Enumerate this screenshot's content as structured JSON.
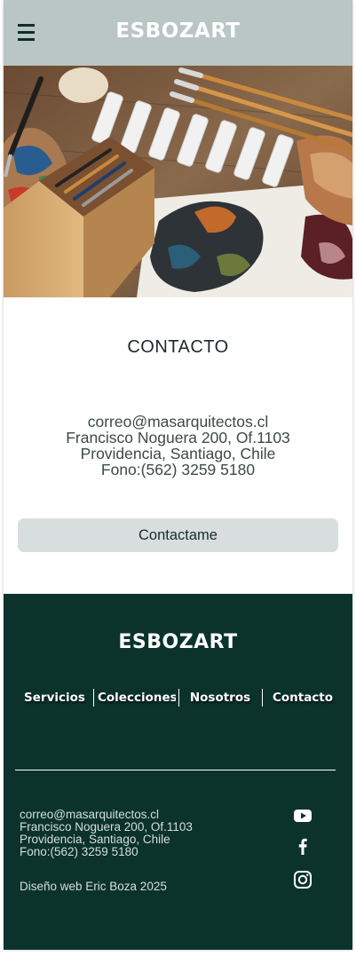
{
  "header": {
    "brand": "ESBOZART",
    "menu_icon": "hamburger-menu-icon"
  },
  "hero": {
    "image": "art-supplies-photo"
  },
  "contact": {
    "title": "CONTACTO",
    "email": "correo@masarquitectos.cl",
    "address_line1": "Francisco Noguera 200, Of.1103",
    "address_line2": "Providencia, Santiago, Chile",
    "phone": "Fono:(562) 3259 5180",
    "button_label": "Contactame"
  },
  "footer": {
    "brand": "ESBOZART",
    "nav": [
      {
        "label": "Servicios"
      },
      {
        "label": "Colecciones"
      },
      {
        "label": "Nosotros"
      },
      {
        "label": "Contacto"
      }
    ],
    "email": "correo@masarquitectos.cl",
    "address_line1": "Francisco Noguera 200, Of.1103",
    "address_line2": "Providencia, Santiago, Chile",
    "phone": "Fono:(562) 3259 5180",
    "credit": "Diseño web Eric Boza 2025",
    "social_icons": [
      "youtube-icon",
      "facebook-icon",
      "instagram-icon"
    ]
  },
  "colors": {
    "header_bg": "#b9c6c3",
    "footer_bg": "#0b332c",
    "button_bg": "#d7dedd",
    "text_dark": "#1a2b2a"
  }
}
